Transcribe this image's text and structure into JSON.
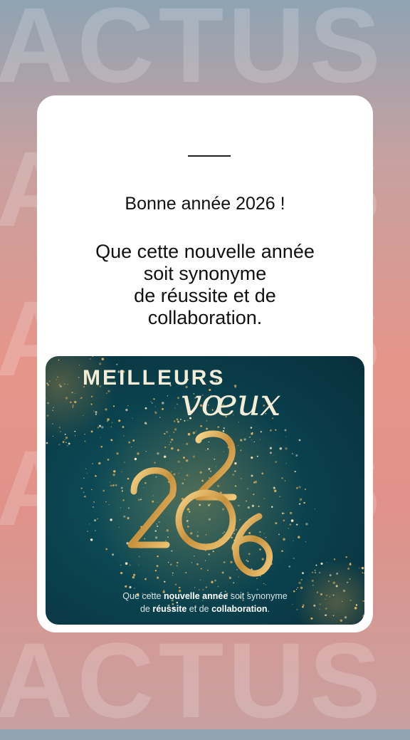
{
  "background": {
    "word": "ACTUS",
    "colors": {
      "top": "#8fa3b3",
      "middle": "#e6958a",
      "bottom": "#c8a0a0"
    }
  },
  "post": {
    "title": "Bonne année 2026 !",
    "message_lines": [
      "Que cette nouvelle année",
      "soit synonyme",
      "de réussite et de",
      "collaboration."
    ]
  },
  "greeting_card": {
    "heading": "MEILLEURS",
    "script_word": "vœux",
    "year": "2026",
    "line1": {
      "a": "Que cette ",
      "b": "nouvelle ",
      "c": "année",
      "d": " soit synonyme"
    },
    "line2": {
      "a": "de ",
      "b": "réussite",
      "c": " et de ",
      "d": "collaboration",
      "e": "."
    },
    "colors": {
      "background": "#0a3f4b",
      "gold": "#d4a24c",
      "cream": "#f3ecd7"
    }
  }
}
